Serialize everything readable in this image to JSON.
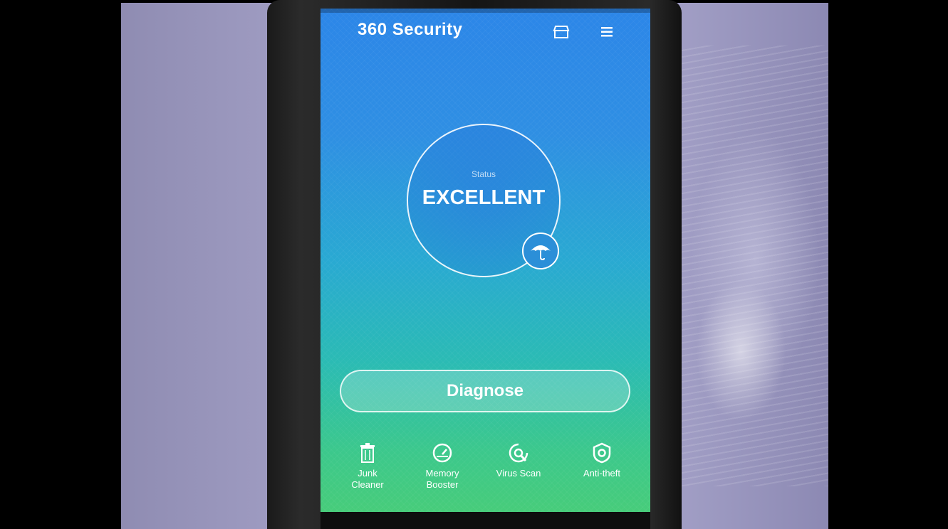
{
  "app": {
    "title": "360 Security"
  },
  "header": {
    "icons": [
      "store-icon",
      "menu-icon"
    ]
  },
  "status": {
    "label": "Status",
    "value": "EXCELLENT",
    "badge_icon": "umbrella-icon"
  },
  "actions": {
    "diagnose_label": "Diagnose"
  },
  "bottom_nav": [
    {
      "label_line1": "Junk",
      "label_line2": "Cleaner",
      "icon": "trash-icon"
    },
    {
      "label_line1": "Memory",
      "label_line2": "Booster",
      "icon": "speedometer-icon"
    },
    {
      "label_line1": "Virus Scan",
      "label_line2": "",
      "icon": "scan-icon"
    },
    {
      "label_line1": "Anti-theft",
      "label_line2": "",
      "icon": "lock-shield-icon"
    }
  ],
  "colors": {
    "screen_top": "#2c86e8",
    "screen_bottom": "#47cc7a",
    "text": "#ffffff"
  }
}
